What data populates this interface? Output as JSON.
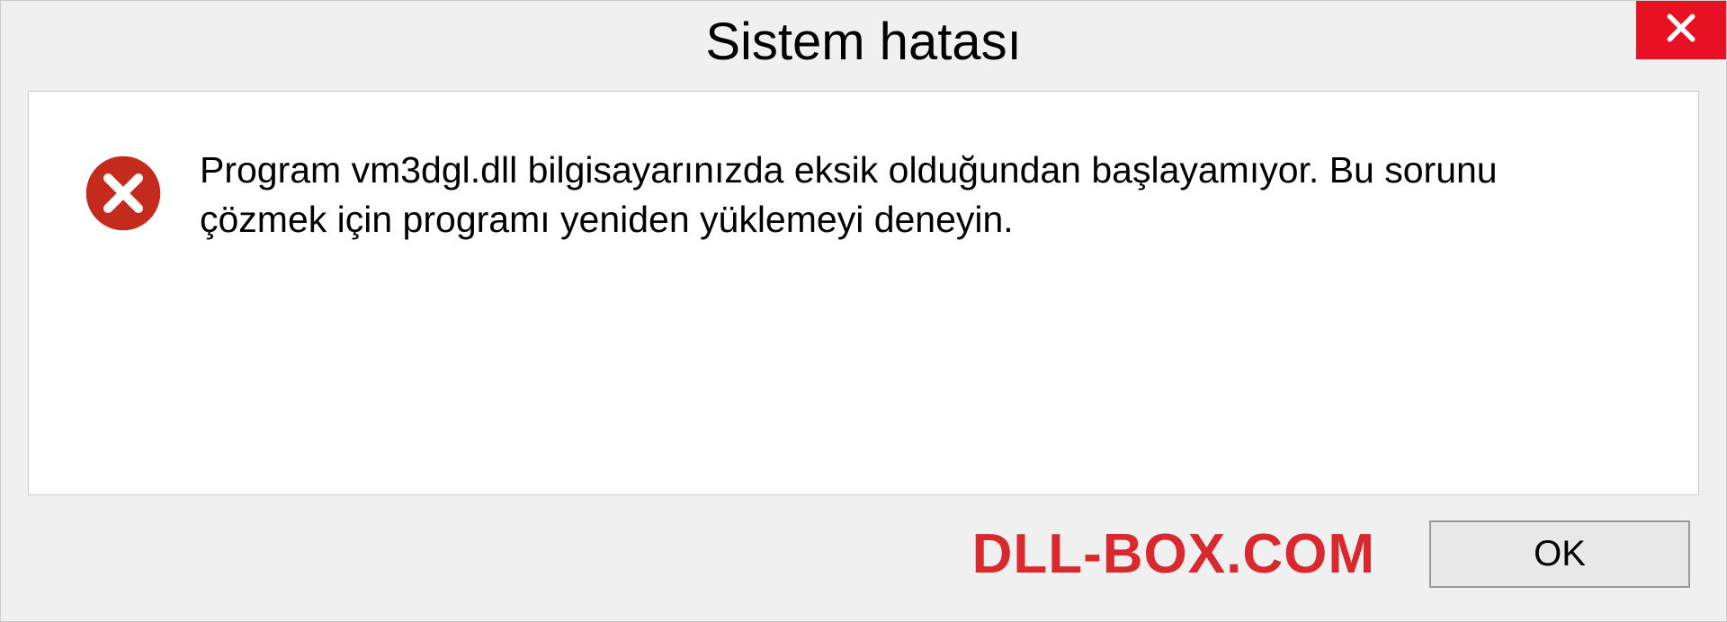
{
  "dialog": {
    "title": "Sistem hatası",
    "message": "Program vm3dgl.dll bilgisayarınızda eksik olduğundan başlayamıyor. Bu sorunu çözmek için programı yeniden yüklemeyi deneyin.",
    "ok_label": "OK"
  },
  "watermark": "DLL-BOX.COM",
  "colors": {
    "close_bg": "#e81123",
    "error_icon": "#c42b1c",
    "watermark": "#d9292f"
  }
}
